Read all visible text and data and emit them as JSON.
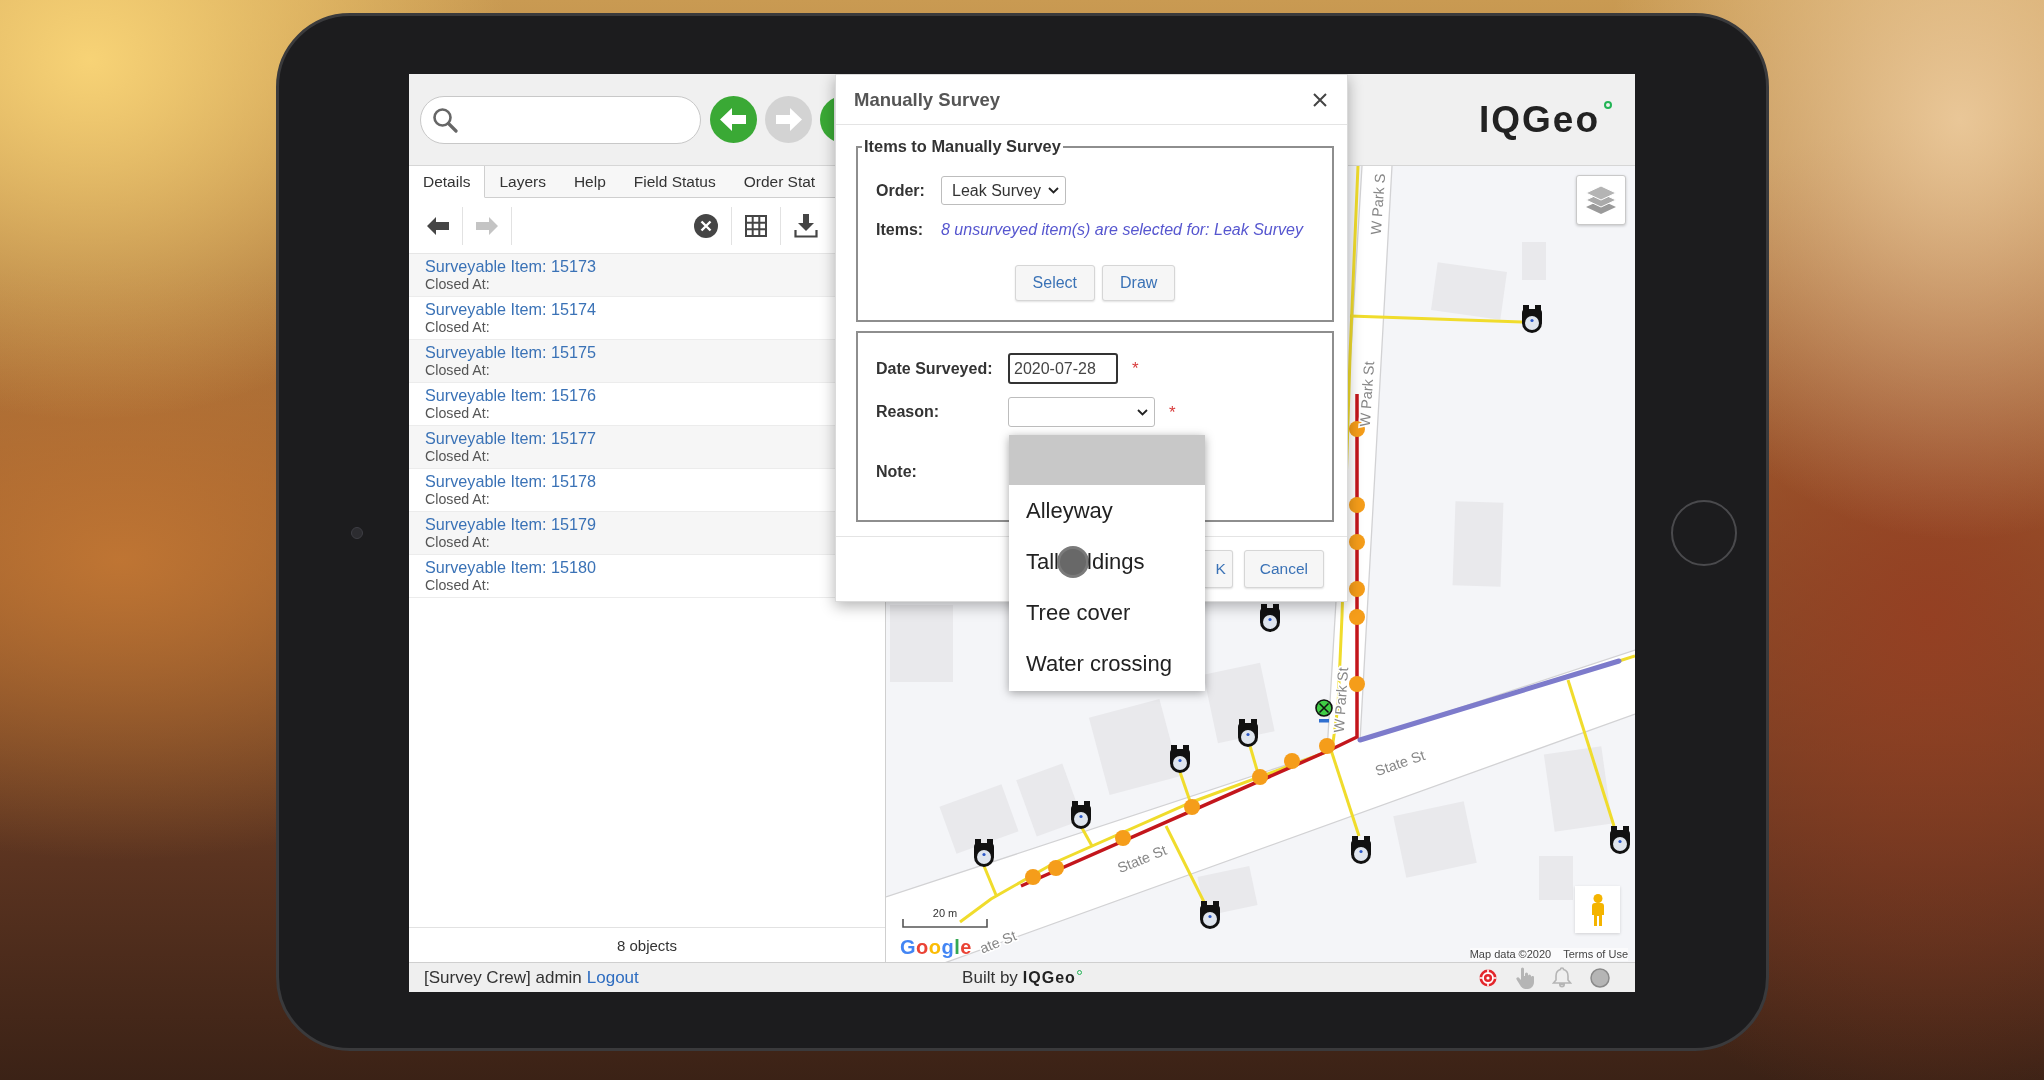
{
  "top_bar": {
    "nav_buttons": [
      {
        "kind": "back",
        "disabled": false
      },
      {
        "kind": "forward",
        "disabled": true
      },
      {
        "kind": "other",
        "disabled": false
      }
    ],
    "logo": "IQGeo"
  },
  "details_panel": {
    "tabs": [
      {
        "label": "Details",
        "selected": true
      },
      {
        "label": "Layers",
        "selected": false
      },
      {
        "label": "Help",
        "selected": false
      },
      {
        "label": "Field Status",
        "selected": false
      },
      {
        "label": "Order Stat",
        "selected": false
      }
    ],
    "toolbar": [
      {
        "kind": "back",
        "disabled": false
      },
      {
        "kind": "forward",
        "disabled": true
      },
      {
        "kind": "clear",
        "disabled": false
      },
      {
        "kind": "table",
        "disabled": false
      },
      {
        "kind": "export",
        "disabled": false
      }
    ],
    "results": [
      {
        "title": "Surveyable Item: 15173",
        "subtitle": "Closed At:"
      },
      {
        "title": "Surveyable Item: 15174",
        "subtitle": "Closed At:"
      },
      {
        "title": "Surveyable Item: 15175",
        "subtitle": "Closed At:"
      },
      {
        "title": "Surveyable Item: 15176",
        "subtitle": "Closed At:"
      },
      {
        "title": "Surveyable Item: 15177",
        "subtitle": "Closed At:"
      },
      {
        "title": "Surveyable Item: 15178",
        "subtitle": "Closed At:"
      },
      {
        "title": "Surveyable Item: 15179",
        "subtitle": "Closed At:"
      },
      {
        "title": "Surveyable Item: 15180",
        "subtitle": "Closed At:"
      }
    ],
    "count": "8 objects"
  },
  "map": {
    "street_labels": [
      "W Park S",
      "W Park St",
      "W Park St",
      "State St",
      "State St",
      "ate St"
    ],
    "scale": "20 m",
    "google_logo": "Google",
    "map_data": "Map data ©2020",
    "terms": "Terms of Use"
  },
  "dialog": {
    "title": "Manually Survey",
    "items_section": {
      "legend": "Items to Manually Survey",
      "order_label": "Order:",
      "order_value": "Leak Survey",
      "items_label": "Items:",
      "items_text": "8 unsurveyed item(s) are selected for: Leak Survey",
      "buttons": [
        "Select",
        "Draw"
      ]
    },
    "details_section": {
      "fields": [
        {
          "kind": "date",
          "label": "Date Surveyed:",
          "value": "2020-07-28",
          "focused": true,
          "required_mark": "*"
        },
        {
          "kind": "select",
          "label": "Reason:",
          "focused": false,
          "required_mark": "*",
          "expanded": true,
          "options": [
            {
              "selected": true,
              "touched": false
            },
            {
              "label": "Alleyway",
              "selected": false,
              "touched": false
            },
            {
              "label": "Tall",
              "label_end": "ldings",
              "selected": false,
              "touched": true
            },
            {
              "label": "Tree cover",
              "selected": false,
              "touched": false
            },
            {
              "label": "Water crossing",
              "selected": false,
              "touched": false
            }
          ]
        },
        {
          "kind": "note",
          "label": "Note:"
        }
      ]
    },
    "footer_buttons": [
      "K",
      "Cancel"
    ]
  },
  "status_bar": {
    "user": "[Survey Crew] admin",
    "logout": "Logout",
    "built_by": "Built by",
    "brand": "IQGeo",
    "icons": [
      {
        "kind": "target",
        "active": true
      },
      {
        "kind": "hand",
        "active": false
      },
      {
        "kind": "bell",
        "active": false
      },
      {
        "kind": "circle",
        "active": false
      }
    ]
  }
}
